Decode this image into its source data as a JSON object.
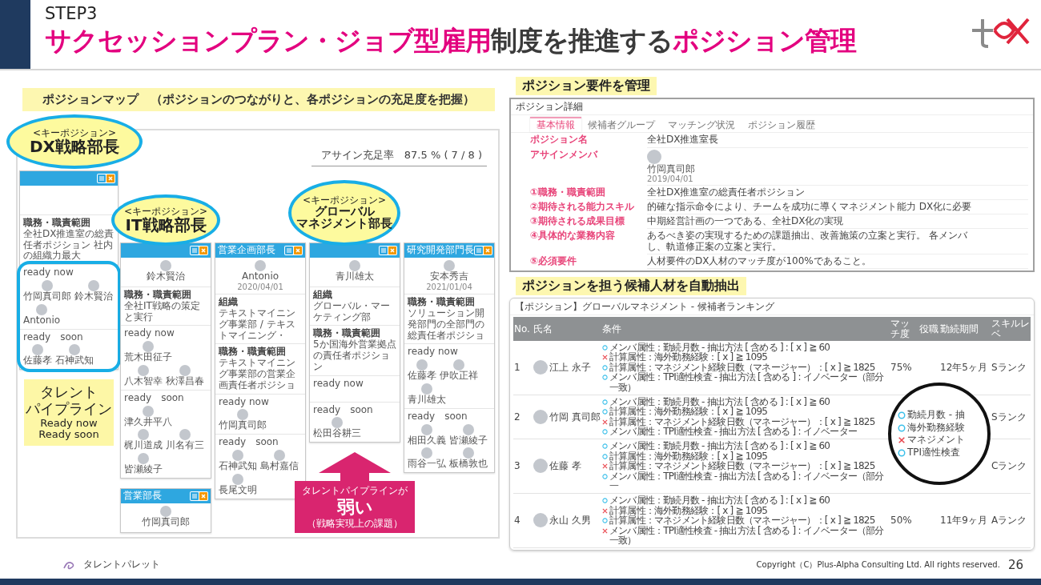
{
  "header": {
    "step": "STEP3",
    "title": [
      {
        "text": "サクセッションプラン・ジョブ型雇用",
        "accent": true
      },
      {
        "text": "制度を推進する",
        "accent": false
      },
      {
        "text": "ポジション管理",
        "accent": true
      }
    ]
  },
  "map": {
    "heading": "ポジションマップ　（ポジションのつながりと、各ポジションの充足度を把握）",
    "fill_rate": "アサイン充足率　87.5 % ( 7 / 8 )",
    "cards": [
      {
        "pipeline_highlight": true,
        "sections": [
          {
            "kind": "text",
            "label": "職務・職責範囲",
            "value": "全社DX推進室の総責任者ポジション 社内の組織力最大"
          },
          {
            "kind": "people",
            "label": "ready now",
            "people": [
              "竹岡真司郎",
              "鈴木賢治",
              "Antonio"
            ]
          },
          {
            "kind": "people",
            "label": "ready　soon",
            "people": [
              "佐藤孝",
              "石神武知"
            ]
          }
        ]
      },
      {
        "pipeline_highlight": false,
        "assignee": {
          "name": "鈴木賢治"
        },
        "sections": [
          {
            "kind": "text",
            "label": "職務・職責範囲",
            "value": "全社IT戦略の策定と実行"
          },
          {
            "kind": "people",
            "label": "ready now",
            "people": [
              "荒木田征子",
              "八木智幸",
              "秋澤昌春"
            ]
          },
          {
            "kind": "people",
            "label": "ready　soon",
            "people": [
              "津久井平八",
              "梶川道成",
              "川名有三",
              "皆瀬綾子"
            ]
          }
        ]
      },
      {
        "pipeline_highlight": false,
        "title": "営業企画部長",
        "assignee": {
          "name": "Antonio",
          "date": "2020/04/01"
        },
        "sections": [
          {
            "kind": "text",
            "label": "組織",
            "value": "テキストマイニング事業部 / テキストマイニング・"
          },
          {
            "kind": "text",
            "label": "職務・職責範囲",
            "value": "テキストマイニング事業部の営業企画責任者ポジショ"
          },
          {
            "kind": "people",
            "label": "ready now",
            "people": [
              "竹岡真司郎"
            ]
          },
          {
            "kind": "people",
            "label": "ready　soon",
            "people": [
              "石神武知",
              "島村嘉信",
              "長尾文明"
            ]
          }
        ]
      },
      {
        "pipeline_highlight": false,
        "assignee": {
          "name": "青川雄太"
        },
        "sections": [
          {
            "kind": "text",
            "label": "組織",
            "value": "グローバル・マーケティング部"
          },
          {
            "kind": "text",
            "label": "職務・職責範囲",
            "value": "5か国海外営業拠点の責任者ポジション"
          },
          {
            "kind": "people",
            "label": "ready now"
          },
          {
            "kind": "people",
            "label": "ready　soon",
            "people": [
              "松田谷耕三"
            ]
          }
        ]
      },
      {
        "pipeline_highlight": false,
        "title": "研究開発部門長",
        "assignee": {
          "name": "安本秀吉",
          "date": "2021/01/04"
        },
        "sections": [
          {
            "kind": "text",
            "label": "職務・職責範囲",
            "value": "ソリューション開発部門の全部門の総責任者ポジショ"
          },
          {
            "kind": "people",
            "label": "ready now",
            "people": [
              "佐藤孝",
              "伊吹正祥",
              "青川雄太"
            ]
          },
          {
            "kind": "people",
            "label": "ready　soon",
            "people": [
              "相田久義",
              "皆瀬綾子",
              "雨谷一弘",
              "板橋敦也"
            ]
          }
        ]
      },
      {
        "title": "営業部長",
        "assignee": {
          "name": "竹岡真司郎"
        }
      }
    ],
    "callouts": [
      {
        "tag": "<キーポジション>",
        "lines": [
          "DX戦略部長"
        ]
      },
      {
        "tag": "<キーポジション>",
        "lines": [
          "IT戦略部長"
        ]
      },
      {
        "tag": "<キーポジション>",
        "lines": [
          "グローバル",
          "マネジメント部長"
        ]
      }
    ],
    "pipeline_note": {
      "lines": [
        "タレント",
        "パイプライン"
      ],
      "sub": [
        "Ready now",
        "Ready soon"
      ]
    },
    "issue": {
      "lead": "タレントパイプラインが",
      "emphasis": "弱い",
      "note": "（戦略実現上の課題）"
    }
  },
  "detail": {
    "heading": "ポジション要件を管理",
    "title": "ポジション詳細",
    "tabs": [
      {
        "label": "基本情報",
        "selected": true
      },
      {
        "label": "候補者グループ",
        "selected": false
      },
      {
        "label": "マッチング状況",
        "selected": false
      },
      {
        "label": "ポジション履歴",
        "selected": false
      }
    ],
    "rows": [
      {
        "kind": "text",
        "label": "ポジション名",
        "lines": [
          "全社DX推進室長"
        ]
      },
      {
        "kind": "member",
        "label": "アサインメンバ",
        "name": "竹岡真司郎",
        "date": "2019/04/01"
      },
      {
        "kind": "text",
        "label": "①職務・職責範囲",
        "lines": [
          "全社DX推進室の総責任者ポジション"
        ]
      },
      {
        "kind": "text",
        "label": "②期待される能力スキル",
        "lines": [
          "的確な指示命令により、チームを成功に導くマネジメント能力 DX化に必要"
        ]
      },
      {
        "kind": "text",
        "label": "③期待される成果目標",
        "lines": [
          "中期経営計画の一つである、全社DX化の実現"
        ]
      },
      {
        "kind": "text",
        "label": "④具体的な業務内容",
        "lines": [
          "あるべき姿の実現するための課題抽出、改善施策の立案と実行。 各メンバ",
          "し、軌道修正案の立案と実行。"
        ]
      },
      {
        "kind": "text",
        "label": "⑤必須要件",
        "lines": [
          "人材要件のDX人材のマッチ度が100%であること。"
        ]
      }
    ]
  },
  "ranking": {
    "heading": "ポジションを担う候補人材を自動抽出",
    "title": "【ポジション】グローバルマネジメント - 候補者ランキング",
    "columns": [
      "No.",
      "氏名",
      "条件",
      "マッチ度",
      "役職",
      "勤続期間",
      "スキルレベ"
    ],
    "rows": [
      {
        "no": "1",
        "name": "江上 永子",
        "match": "75%",
        "tenure": "12年5ヶ月",
        "skill": "Sランク",
        "conditions": [
          {
            "met": true,
            "text": "メンバ属性：勤続月数 - 抽出方法 [ 含める ] : [ x ] ≧ 60"
          },
          {
            "met": false,
            "text": "計算属性：海外勤務経験：[ x ] ≧ 1095"
          },
          {
            "met": true,
            "text": "計算属性：マネジメント経験日数（マネージャー）：[ x ] ≧ 1825"
          },
          {
            "met": true,
            "text": "メンバ属性：TPI適性検査 - 抽出方法 [ 含める ] : イノベーター（部分一致）"
          }
        ]
      },
      {
        "no": "2",
        "name": "竹岡 真司郎",
        "skill": "Sランク",
        "conditions": [
          {
            "met": true,
            "text": "メンバ属性：勤続月数 - 抽出方法 [ 含める ] : [ x ] ≧ 60"
          },
          {
            "met": true,
            "text": "計算属性：海外勤務経験：[ x ] ≧ 1095"
          },
          {
            "met": false,
            "text": "計算属性：マネジメント経験日数（マネージャー）：[ x ] ≧ 1825"
          },
          {
            "met": true,
            "text": "メンバ属性：TPI適性検査 - 抽出方法 [ 含める ] : イノベーター"
          }
        ]
      },
      {
        "no": "3",
        "name": "佐藤 孝",
        "skill": "Cランク",
        "conditions": [
          {
            "met": true,
            "text": "メンバ属性：勤続月数 - 抽出方法 [ 含める ] : [ x ] ≧ 60"
          },
          {
            "met": true,
            "text": "計算属性：海外勤務経験：[ x ] ≧ 1095"
          },
          {
            "met": false,
            "text": "計算属性：マネジメント経験日数（マネージャー）：[ x ] ≧ 1825"
          },
          {
            "met": true,
            "text": "メンバ属性：TPI適性検査 - 抽出方法 [ 含める ] : イノベーター（部分一"
          }
        ]
      },
      {
        "no": "4",
        "name": "永山 久男",
        "match": "50%",
        "tenure": "11年9ヶ月",
        "skill": "Aランク",
        "conditions": [
          {
            "met": true,
            "text": "メンバ属性：勤続月数 - 抽出方法 [ 含める ] : [ x ] ≧ 60"
          },
          {
            "met": false,
            "text": "計算属性：海外勤務経験：[ x ] ≧ 1095"
          },
          {
            "met": true,
            "text": "計算属性：マネジメント経験日数（マネージャー）：[ x ] ≧ 1825"
          },
          {
            "met": false,
            "text": "メンバ属性：TPI適性検査 - 抽出方法 [ 含める ] : イノベーター（部分一致）"
          }
        ]
      }
    ],
    "lens": [
      {
        "met": true,
        "text": "勤続月数 - 抽"
      },
      {
        "met": true,
        "text": "海外勤務経験"
      },
      {
        "met": false,
        "text": "マネジメント"
      },
      {
        "met": true,
        "text": "TPI適性検査"
      }
    ]
  },
  "footer": {
    "brand": "タレントパレット",
    "copyright": "Copyright（C）Plus-Alpha  Consulting Ltd. All rights reserved.",
    "page": "26"
  }
}
